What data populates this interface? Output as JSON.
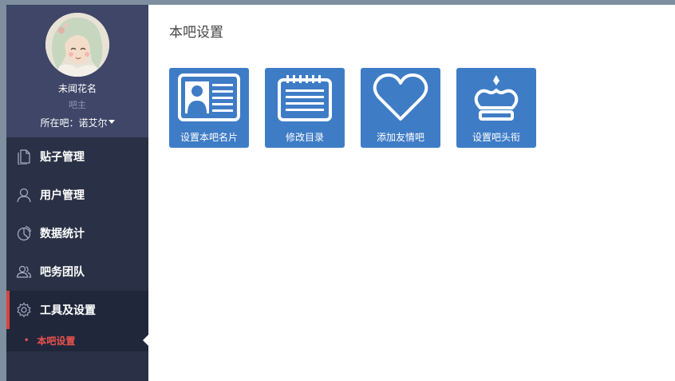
{
  "profile": {
    "username": "未闻花名",
    "role": "吧主",
    "bar_prefix": "所在吧：",
    "bar_name": "诺艾尔"
  },
  "nav": {
    "items": [
      {
        "label": "贴子管理",
        "icon": "document-icon"
      },
      {
        "label": "用户管理",
        "icon": "user-icon"
      },
      {
        "label": "数据统计",
        "icon": "pie-chart-icon"
      },
      {
        "label": "吧务团队",
        "icon": "team-icon"
      },
      {
        "label": "工具及设置",
        "icon": "gear-icon"
      }
    ],
    "sub_items": [
      {
        "label": "本吧设置"
      }
    ]
  },
  "main": {
    "title": "本吧设置",
    "tiles": [
      {
        "label": "设置本吧名片",
        "icon": "id-card-icon"
      },
      {
        "label": "修改目录",
        "icon": "directory-list-icon"
      },
      {
        "label": "添加友情吧",
        "icon": "heart-icon"
      },
      {
        "label": "设置吧头衔",
        "icon": "crown-icon"
      }
    ]
  },
  "colors": {
    "sidebar_bg": "#2a3146",
    "profile_bg": "#3f4668",
    "active_accent": "#d6453d",
    "tile_blue": "#3f7cc6",
    "sub_item_text": "#e8534c"
  }
}
